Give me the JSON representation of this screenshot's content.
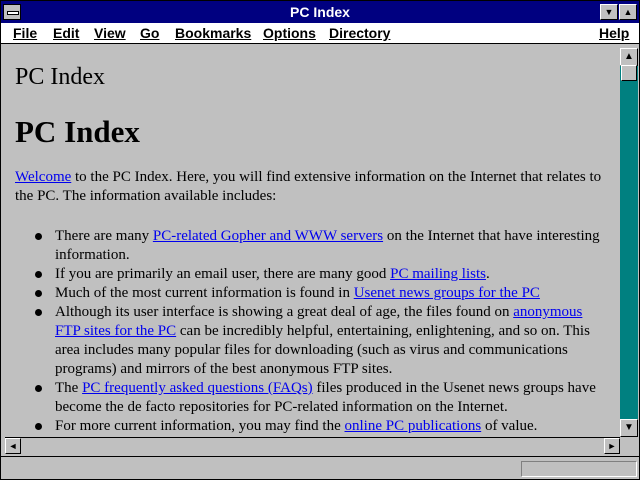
{
  "window": {
    "title": "PC Index",
    "minimize_glyph": "▼",
    "maximize_glyph": "▲"
  },
  "menubar": {
    "file": "File",
    "edit": "Edit",
    "view": "View",
    "go": "Go",
    "bookmarks": "Bookmarks",
    "options": "Options",
    "directory": "Directory",
    "help": "Help"
  },
  "page": {
    "doc_title": "PC Index",
    "heading": "PC Index",
    "intro_link": "Welcome",
    "intro_text": " to the PC Index. Here, you will find extensive information on the Internet that relates to the PC. The information available includes:",
    "items": [
      {
        "pre": "There are many ",
        "link": "PC-related Gopher and WWW servers",
        "post": " on the Internet that have interesting information."
      },
      {
        "pre": "If you are primarily an email user, there are many good ",
        "link": "PC mailing lists",
        "post": "."
      },
      {
        "pre": "Much of the most current information is found in ",
        "link": "Usenet news groups for the PC",
        "post": ""
      },
      {
        "pre": "Although its user interface is showing a great deal of age, the files found on ",
        "link": "anonymous FTP sites for the PC",
        "post": " can be incredibly helpful, entertaining, enlightening, and so on. This area includes many popular files for downloading (such as virus and communications programs) and mirrors of the best anonymous FTP sites."
      },
      {
        "pre": "The ",
        "link": "PC frequently asked questions (FAQs)",
        "post": " files produced in the Usenet news groups have become the de facto repositories for PC-related information on the Internet."
      },
      {
        "pre": "For more current information, you may find the ",
        "link": "online PC publications",
        "post": " of value."
      }
    ]
  },
  "scrollbars": {
    "up": "▲",
    "down": "▼",
    "left": "◄",
    "right": "►"
  }
}
